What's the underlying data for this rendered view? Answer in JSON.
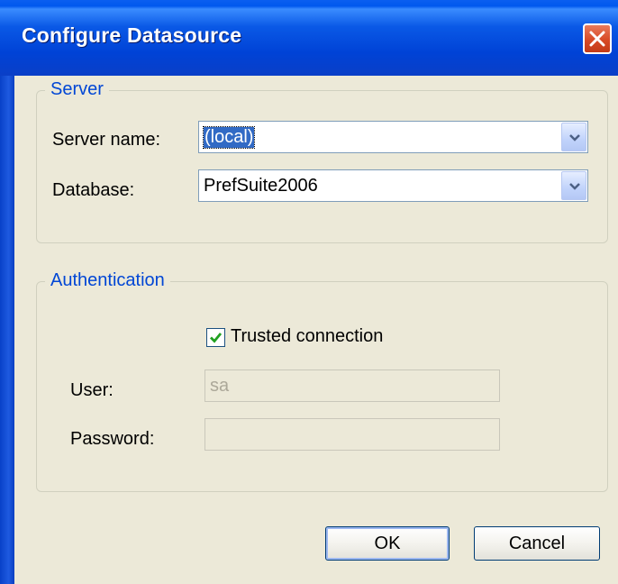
{
  "window": {
    "title": "Configure Datasource"
  },
  "server_group": {
    "legend": "Server",
    "server_name_label": "Server name:",
    "server_name_value": "(local)",
    "database_label": "Database:",
    "database_value": "PrefSuite2006"
  },
  "auth_group": {
    "legend": "Authentication",
    "trusted_label": "Trusted connection",
    "trusted_checked": true,
    "user_label": "User:",
    "user_value": "sa",
    "password_label": "Password:",
    "password_value": ""
  },
  "buttons": {
    "ok": "OK",
    "cancel": "Cancel"
  },
  "colors": {
    "title_bar": "#0a59e6",
    "dialog_bg": "#ece9d8",
    "legend_text": "#0046d5",
    "close_button": "#d84a26"
  }
}
